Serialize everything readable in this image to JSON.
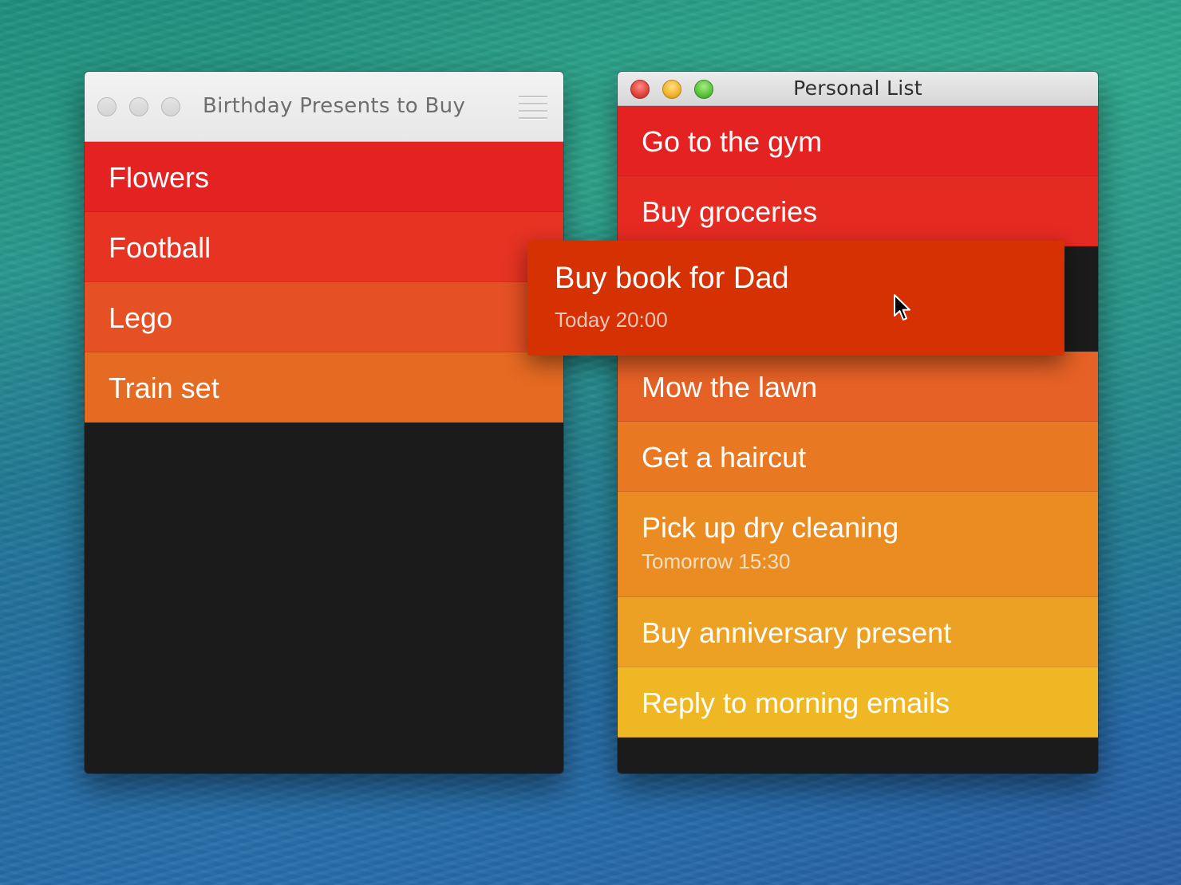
{
  "left_window": {
    "title": "Birthday Presents to Buy",
    "items": [
      {
        "label": "Flowers",
        "color": "#e52222"
      },
      {
        "label": "Football",
        "color": "#e63322"
      },
      {
        "label": "Lego",
        "color": "#e55024"
      },
      {
        "label": "Train set",
        "color": "#e56a22"
      }
    ]
  },
  "right_window": {
    "title": "Personal List",
    "items_above": [
      {
        "label": "Go to the gym",
        "color": "#e52222"
      },
      {
        "label": "Buy groceries",
        "color": "#e52a22"
      }
    ],
    "items_below": [
      {
        "label": "Mow the lawn",
        "color": "#e66125"
      },
      {
        "label": "Get a haircut",
        "color": "#e87822"
      },
      {
        "label": "Pick up dry cleaning",
        "sub": "Tomorrow 15:30",
        "color": "#ea8c22"
      },
      {
        "label": "Buy anniversary present",
        "color": "#eca124"
      },
      {
        "label": "Reply to morning emails",
        "color": "#efb723"
      }
    ]
  },
  "dragged_item": {
    "label": "Buy book for Dad",
    "sub": "Today 20:00",
    "color": "#d53102"
  }
}
